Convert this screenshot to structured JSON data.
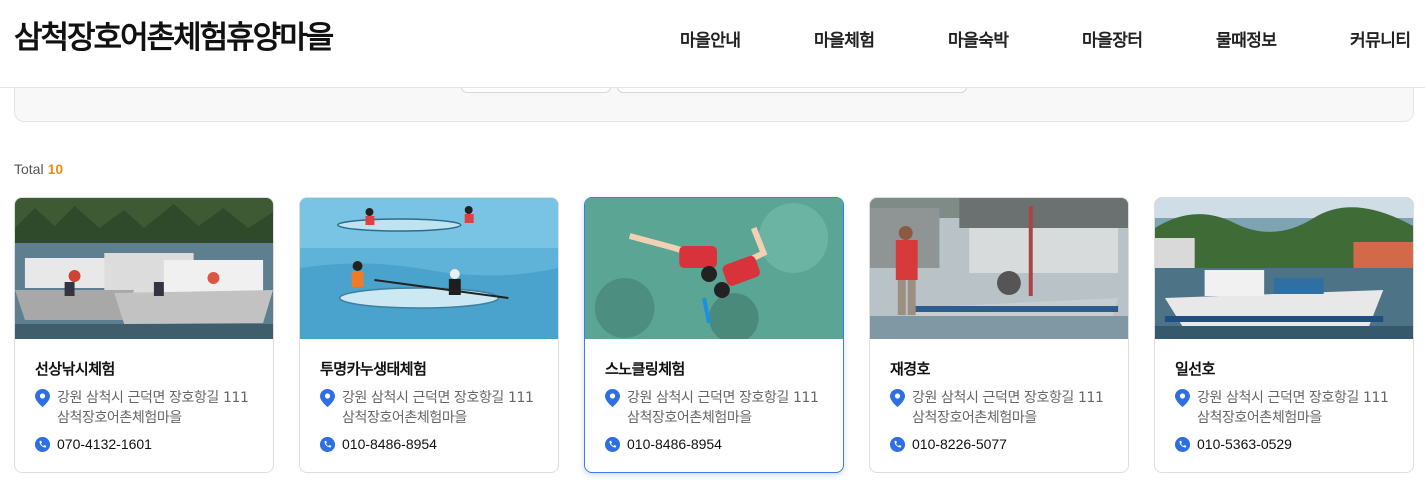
{
  "header": {
    "logo": "삼척장호어촌체험휴양마을",
    "nav": [
      "마을안내",
      "마을체험",
      "마을숙박",
      "마을장터",
      "물때정보",
      "커뮤니티"
    ]
  },
  "list": {
    "total_label": "Total",
    "total_count": "10"
  },
  "cards": [
    {
      "title": "선상낚시체험",
      "address_line1": "강원 삼척시 근덕면 장호항길 111",
      "address_line2": "삼척장호어촌체험마을",
      "phone": "070-4132-1601",
      "image": "harbor-boats-photo"
    },
    {
      "title": "투명카누생태체험",
      "address_line1": "강원 삼척시 근덕면 장호항길 111",
      "address_line2": "삼척장호어촌체험마을",
      "phone": "010-8486-8954",
      "image": "clear-canoe-photo"
    },
    {
      "title": "스노클링체험",
      "address_line1": "강원 삼척시 근덕면 장호항길 111",
      "address_line2": "삼척장호어촌체험마을",
      "phone": "010-8486-8954",
      "image": "snorkeling-photo"
    },
    {
      "title": "재경호",
      "address_line1": "강원 삼척시 근덕면 장호항길 111",
      "address_line2": "삼척장호어촌체험마을",
      "phone": "010-8226-5077",
      "image": "fishing-boat-dock-photo"
    },
    {
      "title": "일선호",
      "address_line1": "강원 삼척시 근덕면 장호항길 111",
      "address_line2": "삼척장호어촌체험마을",
      "phone": "010-5363-0529",
      "image": "boat-harbor-photo"
    }
  ],
  "colors": {
    "accent_orange": "#f08a17",
    "accent_blue": "#2f6fe4",
    "active_border": "#3d7be6"
  },
  "icons": {
    "location": "map-pin-icon",
    "phone": "phone-icon"
  }
}
